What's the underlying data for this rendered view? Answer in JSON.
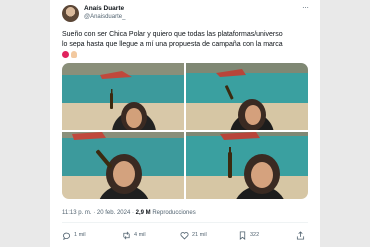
{
  "tweet": {
    "author_name": "Anaís Duarte",
    "author_handle": "@Anaisduarte_",
    "more_label": "···",
    "text_line1": "Sueño con ser Chica Polar y quiero que todas las plataformas/universo",
    "text_line2": "lo sepa hasta que llegue a mí una propuesta de campaña con la marca",
    "emojis": [
      "heart-emoji",
      "hands-emoji"
    ],
    "photos": [
      "beach-photo-1",
      "beach-photo-2",
      "beach-photo-3",
      "beach-photo-4"
    ],
    "time": "11:13 p. m.",
    "date": "20 feb. 2024",
    "separator": "·",
    "views_count": "2,9 M",
    "views_label": "Reproducciones",
    "stats": {
      "replies": "1 mil",
      "reposts": "4 mil",
      "likes": "21 mil",
      "bookmarks": "322"
    }
  },
  "colors": {
    "text": "#0f1419",
    "secondary": "#536471",
    "sea": "#3c9a9c",
    "sand": "#d8c8a8"
  }
}
